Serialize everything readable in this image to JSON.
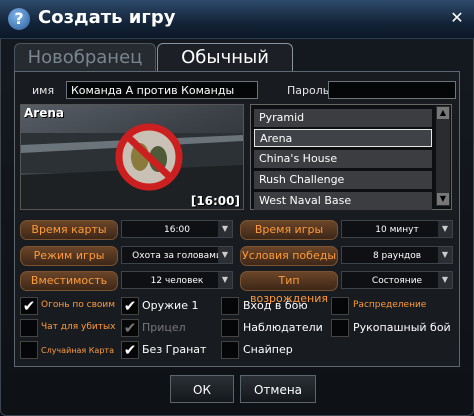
{
  "window": {
    "title": "Создать игру",
    "close": "✕"
  },
  "tabs": [
    {
      "label": "Новобранец"
    },
    {
      "label": "Обычный"
    }
  ],
  "form": {
    "name_label": "имя",
    "name_value": "Команда А против Команды",
    "password_label": "Пароль",
    "password_value": ""
  },
  "map": {
    "name": "Arena",
    "time": "[16:00]"
  },
  "map_list": {
    "items": [
      "Pyramid",
      "Arena",
      "China's House",
      "Rush Challenge",
      "West Naval Base"
    ],
    "selected": "Arena"
  },
  "settings": {
    "map_time": {
      "label": "Время карты",
      "value": "16:00"
    },
    "game_time": {
      "label": "Время игры",
      "value": "10 минут"
    },
    "game_mode": {
      "label": "Режим игры",
      "value": "Охота за головами"
    },
    "win_condition": {
      "label": "Условия победы",
      "value": "8 раундов"
    },
    "capacity": {
      "label": "Вместимость",
      "value": "12 человек"
    },
    "respawn": {
      "label": "Тип возрождения",
      "value": "Состояние"
    }
  },
  "options": {
    "friendly_fire": {
      "label": "Огонь по своим",
      "checked": true
    },
    "dead_chat": {
      "label": "Чат для убитых",
      "checked": false
    },
    "random_map": {
      "label": "Случайная Карта",
      "checked": false
    },
    "weapon1": {
      "label": "Оружие 1",
      "checked": true
    },
    "crosshair": {
      "label": "Прицел",
      "checked": true
    },
    "no_grenades": {
      "label": "Без Гранат",
      "checked": true
    },
    "join_in_battle": {
      "label": "Вход в бою",
      "checked": false
    },
    "observers": {
      "label": "Наблюдатели",
      "checked": false
    },
    "sniper": {
      "label": "Снайпер",
      "checked": false
    },
    "distribution": {
      "label": "Распределение",
      "checked": false
    },
    "melee": {
      "label": "Рукопашный бой",
      "checked": false
    }
  },
  "buttons": {
    "ok": "ОК",
    "cancel": "Отмена"
  },
  "colors": {
    "accent_orange": "#ff9a3a",
    "title_blue": "#2e4a6c"
  }
}
